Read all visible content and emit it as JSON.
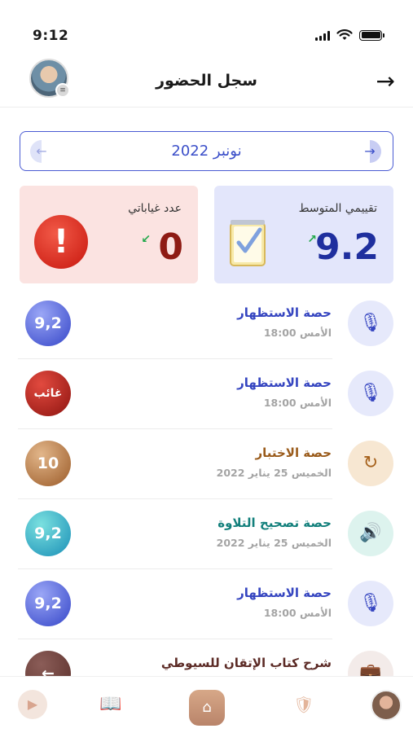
{
  "status": {
    "time": "9:12"
  },
  "header": {
    "title": "سجل الحضور",
    "back_icon": "arrow-right-icon"
  },
  "month_selector": {
    "label": "نونبر 2022"
  },
  "stats": {
    "average": {
      "title": "تقييمي المتوسط",
      "value": "9.2"
    },
    "absences": {
      "title": "عدد غياباتي",
      "value": "0"
    }
  },
  "sessions": [
    {
      "title": "حصة الاستظهار",
      "subtitle": "الأمس 18:00",
      "score": "9,2",
      "icon": "mic-icon"
    },
    {
      "title": "حصة الاستظهار",
      "subtitle": "الأمس 18:00",
      "score": "غائب",
      "icon": "mic-icon"
    },
    {
      "title": "حصة الاختبار",
      "subtitle": "الخميس 25 يناير 2022",
      "score": "10",
      "icon": "retry-icon"
    },
    {
      "title": "حصة تصحيح التلاوة",
      "subtitle": "الخميس 25 يناير 2022",
      "score": "9,2",
      "icon": "speaker-icon"
    },
    {
      "title": "حصة الاستظهار",
      "subtitle": "الأمس 18:00",
      "score": "9,2",
      "icon": "mic-icon"
    },
    {
      "title": "شرح كتاب الإتقان للسيوطي",
      "subtitle": "",
      "score": "",
      "icon": "bag-icon"
    }
  ],
  "colors": {
    "accent": "#3b4fc9",
    "absent": "#8e1410",
    "brown": "#9a5b1b",
    "teal": "#13807c"
  }
}
